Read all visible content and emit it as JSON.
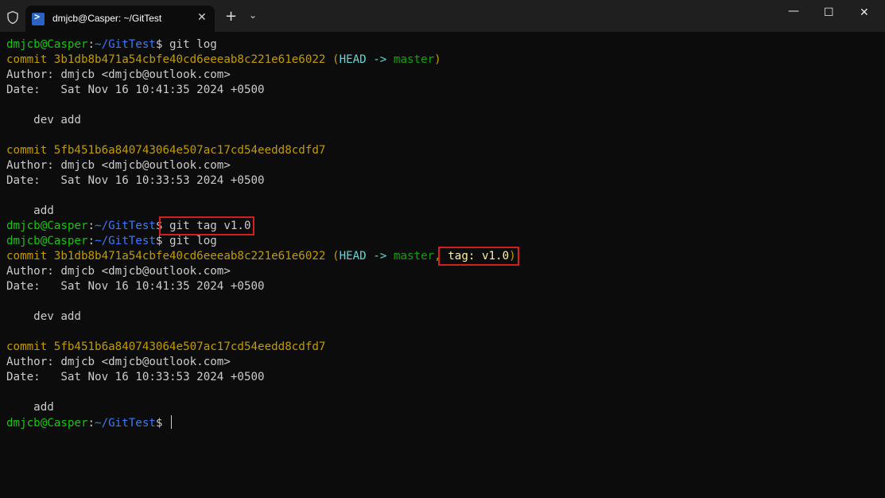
{
  "window": {
    "tab_title": "dmjcb@Casper: ~/GitTest",
    "close_glyph": "✕",
    "new_tab_glyph": "+",
    "dropdown_glyph": "⌄",
    "minimize_glyph": "—",
    "maximize_glyph": "☐",
    "close_window_glyph": "✕",
    "icons": [
      "shield-icon",
      "powershell-icon"
    ]
  },
  "prompt": {
    "user_host": "dmjcb@Casper",
    "sep": ":",
    "path": "~/GitTest",
    "dollar": "$"
  },
  "commands": [
    "git log",
    "git tag v1.0",
    "git log"
  ],
  "log1": [
    {
      "commit": "commit 3b1db8b471a54cbfe40cd6eeeab8c221e61e6022",
      "open": " (",
      "head": "HEAD -> ",
      "branch": "master",
      "close": ")",
      "author": "Author: dmjcb <dmjcb@outlook.com>",
      "date": "Date:   Sat Nov 16 10:41:35 2024 +0500",
      "message": "    dev add"
    },
    {
      "commit": "commit 5fb451b6a840743064e507ac17cd54eedd8cdfd7",
      "author": "Author: dmjcb <dmjcb@outlook.com>",
      "date": "Date:   Sat Nov 16 10:33:53 2024 +0500",
      "message": "    add"
    }
  ],
  "log2": [
    {
      "commit": "commit 3b1db8b471a54cbfe40cd6eeeab8c221e61e6022",
      "open": " (",
      "head": "HEAD -> ",
      "branch": "master",
      "comma": ",",
      "tag": " tag: v1.0",
      "close": ")",
      "author": "Author: dmjcb <dmjcb@outlook.com>",
      "date": "Date:   Sat Nov 16 10:41:35 2024 +0500",
      "message": "    dev add"
    },
    {
      "commit": "commit 5fb451b6a840743064e507ac17cd54eedd8cdfd7",
      "author": "Author: dmjcb <dmjcb@outlook.com>",
      "date": "Date:   Sat Nov 16 10:33:53 2024 +0500",
      "message": "    add"
    }
  ],
  "colors": {
    "prompt_user": "#16c60c",
    "prompt_path": "#3b78ff",
    "commit_hash": "#c19c00",
    "head": "#61d6d6",
    "branch": "#13a10e",
    "tag": "#f9f1a5",
    "highlight_box": "#d21f1f"
  }
}
